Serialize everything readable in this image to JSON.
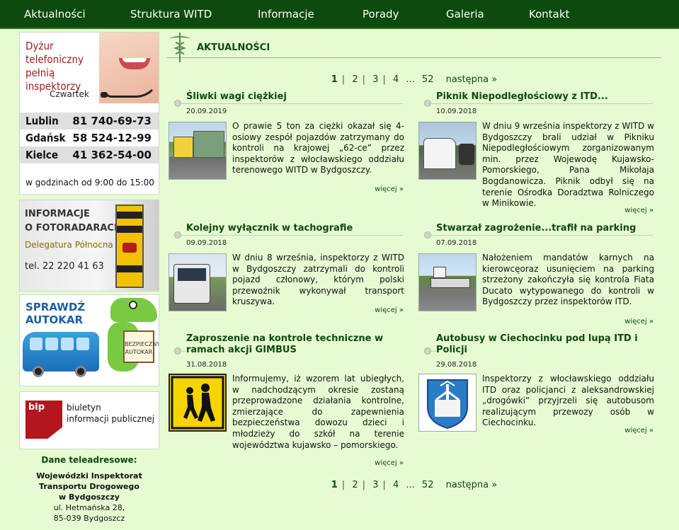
{
  "nav": {
    "items": [
      "Aktualności",
      "Struktura WITD",
      "Informacje",
      "Porady",
      "Galeria",
      "Kontakt"
    ]
  },
  "sidebar": {
    "duty": {
      "heading": "Dyżur telefoniczny pełnią inspektorzy",
      "day": "Czwartek",
      "phones": [
        {
          "city": "Lublin",
          "number": "81 740-69-73"
        },
        {
          "city": "Gdańsk",
          "number": "58 524-12-99"
        },
        {
          "city": "Kielce",
          "number": "41 362-54-00"
        }
      ],
      "hours": "w godzinach od 9:00 do 15:00"
    },
    "radar": {
      "title_line1": "INFORMACJE",
      "title_line2": "O FOTORADARACH",
      "branch": "Delegatura Północna",
      "phone": "tel. 22 220 41 63"
    },
    "bus": {
      "line1": "SPRAWDŹ",
      "line2": "AUTOKAR",
      "sign_line1": "BEZPIECZNY",
      "sign_line2": "AUTOKAR"
    },
    "bip": {
      "mark": "bip",
      "line1": "biuletyn",
      "line2": "informacji publicznej"
    },
    "contact": {
      "heading": "Dane teleadresowe:",
      "org_line1": "Wojewódzki Inspektorat",
      "org_line2": "Transportu Drogowego",
      "org_line3": "w Bydgoszczy",
      "street": "ul. Hetmańska 28,",
      "city": "85-039 Bydgoszcz"
    }
  },
  "main": {
    "section_title": "AKTUALNOŚCI",
    "pager": {
      "pages": [
        "1",
        "2",
        "3",
        "4"
      ],
      "ellipsis": "...",
      "last": "52",
      "next": "następna »",
      "sep": "|"
    },
    "more_label": "więcej »",
    "articles": [
      {
        "title": "Śliwki wagi ciężkiej",
        "date": "20.09.2019",
        "text": "O prawie 5 ton za ciężki okazał się 4-osiowy zespół pojazdów zatrzymany do kontroli na krajowej „62-ce” przez inspektorów z włocławskiego oddziału terenowego WITD w Bydgoszczy.",
        "image": "truck-photo"
      },
      {
        "title": "Piknik Niepodległościowy z ITD...",
        "date": "10.09.2018",
        "text": "W dniu 9 września inspektorzy z WITD w Bydgoszczy brali udział w Pikniku Niepodległościowym zorganizowanym min. przez Wojewodę Kujawsko-Pomorskiego, Pana Mikołaja Bogdanowicza. Piknik odbył się na terenie Ośrodka Doradztwa Rolniczego w Minikowie.",
        "image": "van-photo"
      },
      {
        "title": "Kolejny wyłącznik w tachografie",
        "date": "09.09.2018",
        "text": "W dniu 8 września, inspektorzy z WITD w Bydgoszczy zatrzymali do kontroli pojazd członowy, którym polski przewoźnik wykonywał transport kruszywa.",
        "image": "tractor-photo"
      },
      {
        "title": "Stwarzał zagrożenie...trafił na parking",
        "date": "07.09.2018",
        "text": "Nałożeniem mandatów karnych na kierowcęoraz usunięciem na parking strzeżony zakończyła się kontrola Fiata Ducato wytypowanego do kontroli w Bydgoszczy przez inspektorów ITD.",
        "image": "tow-photo"
      },
      {
        "title": "Zaproszenie na kontrole techniczne w ramach akcji GIMBUS",
        "date": "31.08.2018",
        "text": "Informujemy, iż wzorem lat ubiegłych, w nadchodzącym okresie zostaną przeprowadzone działania kontrolne, zmierzające do zapewnienia bezpieczeństwa dowozu dzieci i młodzieży do szkół na terenie województwa kujawsko – pomorskiego.",
        "image": "children-sign"
      },
      {
        "title": "Autobusy w Ciechocinku pod lupą ITD i Policji",
        "date": "29.08.2018",
        "text": "Inspektorzy z włocławskiego oddziału ITD oraz policjanci z aleksandrowskiej „drogówki” przyjrzeli się autobusom realizującym przewozy osób w Ciechocinku.",
        "image": "coat-of-arms"
      }
    ]
  }
}
